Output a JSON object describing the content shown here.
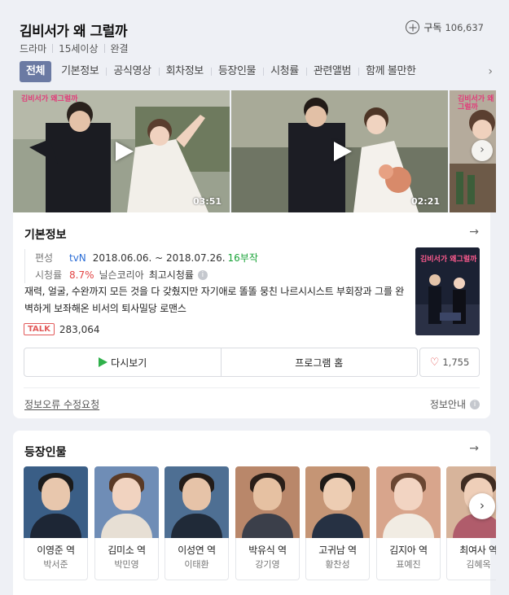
{
  "header": {
    "title": "김비서가 왜 그럴까",
    "meta": [
      "드라마",
      "15세이상",
      "완결"
    ],
    "subscribe_label": "구독",
    "subscriber_count": "106,637"
  },
  "tabs": [
    {
      "label": "전체",
      "active": true
    },
    {
      "label": "기본정보"
    },
    {
      "label": "공식영상"
    },
    {
      "label": "회차정보"
    },
    {
      "label": "등장인물"
    },
    {
      "label": "시청률"
    },
    {
      "label": "관련앨범"
    },
    {
      "label": "함께 볼만한"
    }
  ],
  "videos": [
    {
      "duration": "03:51",
      "logo": "김비서가 왜그럴까"
    },
    {
      "duration": "02:21",
      "logo": "김비서가 왜그럴까"
    },
    {
      "duration": "",
      "logo": "김비서가 왜그럴까"
    }
  ],
  "info": {
    "section_title": "기본정보",
    "broadcast_label": "편성",
    "channel": "tvN",
    "dates": "2018.06.06. ~ 2018.07.26.",
    "episodes": "16부작",
    "rating_label": "시청률",
    "rating": "8.7%",
    "rating_source": "닐슨코리아",
    "rating_note": "최고시청률",
    "description": "재력, 얼굴, 수완까지 모든 것을 다 갖췄지만 자기애로 똘똘 뭉친 나르시시스트 부회장과 그를 완벽하게 보좌해온 비서의 퇴사밀당 로맨스",
    "talk_badge": "TALK",
    "talk_count": "283,064",
    "poster_title": "김비서가 왜그럴까",
    "rewatch_label": "다시보기",
    "program_home_label": "프로그램 홈",
    "like_count": "1,755",
    "report_link": "정보오류 수정요청",
    "info_guide": "정보안내"
  },
  "cast": {
    "section_title": "등장인물",
    "people": [
      {
        "role": "이영준 역",
        "actor": "박서준",
        "bg": "#3a5e86",
        "skin": "#e8c7ad",
        "hair": "#1b1b1b",
        "suit": "#1d2635"
      },
      {
        "role": "김미소 역",
        "actor": "박민영",
        "bg": "#6f8db6",
        "skin": "#f1d3c0",
        "hair": "#5a3a26",
        "suit": "#e7dfd4"
      },
      {
        "role": "이성연 역",
        "actor": "이태환",
        "bg": "#4e6f93",
        "skin": "#e6c3a8",
        "hair": "#231c18",
        "suit": "#202a38"
      },
      {
        "role": "박유식 역",
        "actor": "강기영",
        "bg": "#b9876a",
        "skin": "#e6c1a2",
        "hair": "#2a1f19",
        "suit": "#3b3f4a"
      },
      {
        "role": "고귀남 역",
        "actor": "황찬성",
        "bg": "#c59575",
        "skin": "#edcdb3",
        "hair": "#1e1a17",
        "suit": "#263143"
      },
      {
        "role": "김지아 역",
        "actor": "표예진",
        "bg": "#d8a58c",
        "skin": "#f2d4c2",
        "hair": "#6a4632",
        "suit": "#f1ece3"
      },
      {
        "role": "최여사 역",
        "actor": "김혜옥",
        "bg": "#d7b49b",
        "skin": "#efcfb9",
        "hair": "#3f2c22",
        "suit": "#b05c6b"
      }
    ]
  },
  "colors": {
    "accent": "#6b7aa3",
    "channel": "#2b6dd6",
    "episodes": "#1aa338",
    "rating": "#e24444"
  }
}
